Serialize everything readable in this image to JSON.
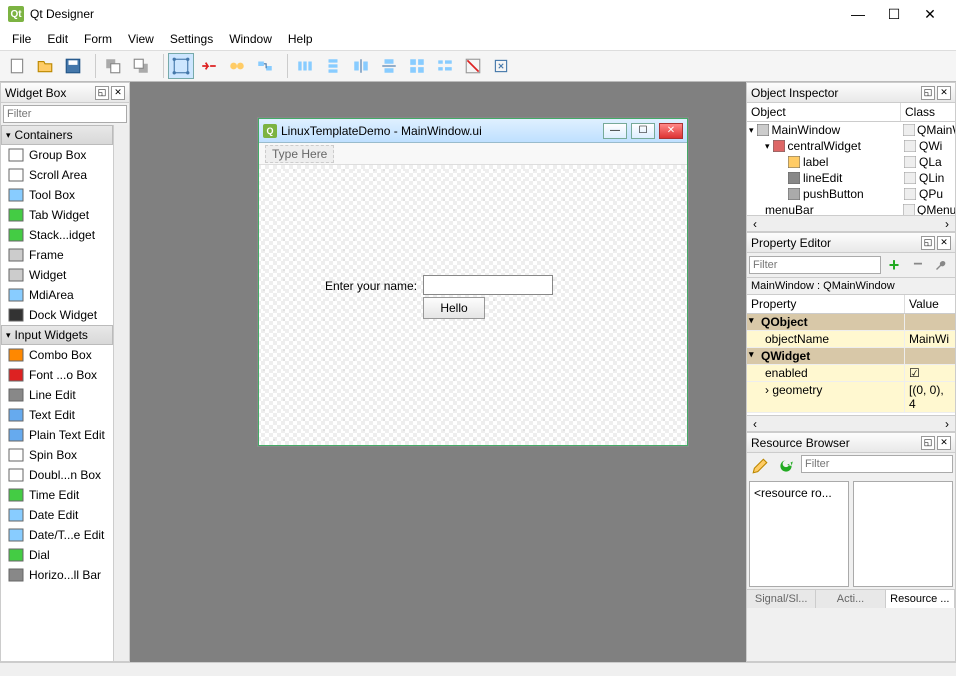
{
  "window": {
    "title": "Qt Designer"
  },
  "menu": {
    "items": [
      "File",
      "Edit",
      "Form",
      "View",
      "Settings",
      "Window",
      "Help"
    ]
  },
  "widgetBox": {
    "title": "Widget Box",
    "filterPlaceholder": "Filter",
    "groups": {
      "containers": "Containers",
      "inputWidgets": "Input Widgets"
    },
    "containers": [
      "Group Box",
      "Scroll Area",
      "Tool Box",
      "Tab Widget",
      "Stack...idget",
      "Frame",
      "Widget",
      "MdiArea",
      "Dock Widget"
    ],
    "inputWidgets": [
      "Combo Box",
      "Font ...o Box",
      "Line Edit",
      "Text Edit",
      "Plain Text Edit",
      "Spin Box",
      "Doubl...n Box",
      "Time Edit",
      "Date Edit",
      "Date/T...e Edit",
      "Dial",
      "Horizo...ll Bar"
    ]
  },
  "designWindow": {
    "title": "LinuxTemplateDemo - MainWindow.ui",
    "menuPlaceholder": "Type Here",
    "label": "Enter your name:",
    "button": "Hello"
  },
  "objectInspector": {
    "title": "Object Inspector",
    "headers": {
      "object": "Object",
      "class": "Class"
    },
    "rows": [
      {
        "indent": 0,
        "caret": "▾",
        "name": "MainWindow",
        "class": "QMainWin",
        "icon": "window"
      },
      {
        "indent": 1,
        "caret": "▾",
        "name": "centralWidget",
        "class": "QWi",
        "icon": "grid"
      },
      {
        "indent": 2,
        "caret": "",
        "name": "label",
        "class": "QLa",
        "icon": "tag"
      },
      {
        "indent": 2,
        "caret": "",
        "name": "lineEdit",
        "class": "QLin",
        "icon": "edit"
      },
      {
        "indent": 2,
        "caret": "",
        "name": "pushButton",
        "class": "QPu",
        "icon": "btn"
      },
      {
        "indent": 1,
        "caret": "",
        "name": "menuBar",
        "class": "QMenuB",
        "icon": ""
      }
    ]
  },
  "propertyEditor": {
    "title": "Property Editor",
    "filterPlaceholder": "Filter",
    "label": "MainWindow : QMainWindow",
    "headers": {
      "property": "Property",
      "value": "Value"
    },
    "rows": [
      {
        "type": "section",
        "name": "QObject",
        "value": ""
      },
      {
        "type": "yellow",
        "name": "objectName",
        "value": "MainWi"
      },
      {
        "type": "section",
        "name": "QWidget",
        "value": ""
      },
      {
        "type": "yellow",
        "name": "enabled",
        "value": "☑"
      },
      {
        "type": "yellow",
        "name": "geometry",
        "value": "[(0, 0), 4",
        "caret": "›"
      }
    ]
  },
  "resourceBrowser": {
    "title": "Resource Browser",
    "filterPlaceholder": "Filter",
    "rootLabel": "<resource ro...",
    "tabs": [
      "Signal/Sl...",
      "Acti...",
      "Resource ..."
    ]
  }
}
